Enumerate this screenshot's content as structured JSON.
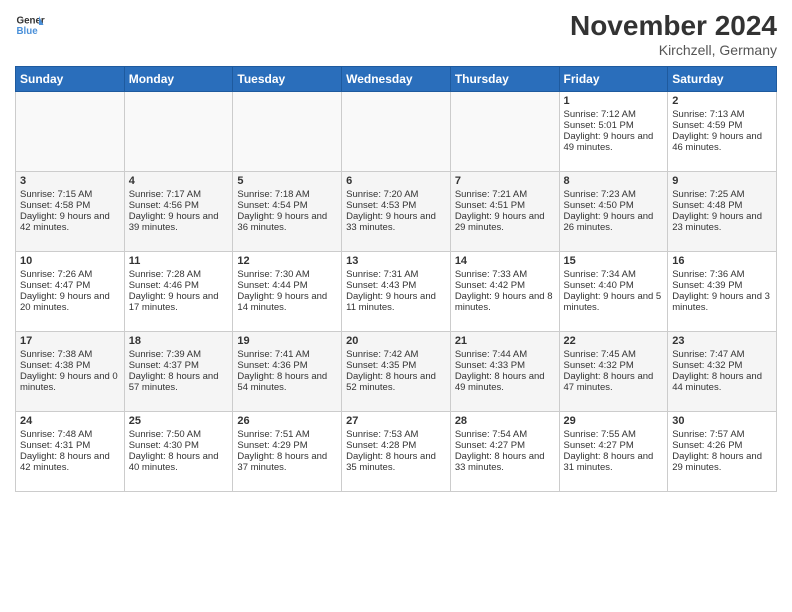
{
  "header": {
    "logo_line1": "General",
    "logo_line2": "Blue",
    "month": "November 2024",
    "location": "Kirchzell, Germany"
  },
  "weekdays": [
    "Sunday",
    "Monday",
    "Tuesday",
    "Wednesday",
    "Thursday",
    "Friday",
    "Saturday"
  ],
  "weeks": [
    [
      {
        "day": "",
        "info": ""
      },
      {
        "day": "",
        "info": ""
      },
      {
        "day": "",
        "info": ""
      },
      {
        "day": "",
        "info": ""
      },
      {
        "day": "",
        "info": ""
      },
      {
        "day": "1",
        "info": "Sunrise: 7:12 AM\nSunset: 5:01 PM\nDaylight: 9 hours and 49 minutes."
      },
      {
        "day": "2",
        "info": "Sunrise: 7:13 AM\nSunset: 4:59 PM\nDaylight: 9 hours and 46 minutes."
      }
    ],
    [
      {
        "day": "3",
        "info": "Sunrise: 7:15 AM\nSunset: 4:58 PM\nDaylight: 9 hours and 42 minutes."
      },
      {
        "day": "4",
        "info": "Sunrise: 7:17 AM\nSunset: 4:56 PM\nDaylight: 9 hours and 39 minutes."
      },
      {
        "day": "5",
        "info": "Sunrise: 7:18 AM\nSunset: 4:54 PM\nDaylight: 9 hours and 36 minutes."
      },
      {
        "day": "6",
        "info": "Sunrise: 7:20 AM\nSunset: 4:53 PM\nDaylight: 9 hours and 33 minutes."
      },
      {
        "day": "7",
        "info": "Sunrise: 7:21 AM\nSunset: 4:51 PM\nDaylight: 9 hours and 29 minutes."
      },
      {
        "day": "8",
        "info": "Sunrise: 7:23 AM\nSunset: 4:50 PM\nDaylight: 9 hours and 26 minutes."
      },
      {
        "day": "9",
        "info": "Sunrise: 7:25 AM\nSunset: 4:48 PM\nDaylight: 9 hours and 23 minutes."
      }
    ],
    [
      {
        "day": "10",
        "info": "Sunrise: 7:26 AM\nSunset: 4:47 PM\nDaylight: 9 hours and 20 minutes."
      },
      {
        "day": "11",
        "info": "Sunrise: 7:28 AM\nSunset: 4:46 PM\nDaylight: 9 hours and 17 minutes."
      },
      {
        "day": "12",
        "info": "Sunrise: 7:30 AM\nSunset: 4:44 PM\nDaylight: 9 hours and 14 minutes."
      },
      {
        "day": "13",
        "info": "Sunrise: 7:31 AM\nSunset: 4:43 PM\nDaylight: 9 hours and 11 minutes."
      },
      {
        "day": "14",
        "info": "Sunrise: 7:33 AM\nSunset: 4:42 PM\nDaylight: 9 hours and 8 minutes."
      },
      {
        "day": "15",
        "info": "Sunrise: 7:34 AM\nSunset: 4:40 PM\nDaylight: 9 hours and 5 minutes."
      },
      {
        "day": "16",
        "info": "Sunrise: 7:36 AM\nSunset: 4:39 PM\nDaylight: 9 hours and 3 minutes."
      }
    ],
    [
      {
        "day": "17",
        "info": "Sunrise: 7:38 AM\nSunset: 4:38 PM\nDaylight: 9 hours and 0 minutes."
      },
      {
        "day": "18",
        "info": "Sunrise: 7:39 AM\nSunset: 4:37 PM\nDaylight: 8 hours and 57 minutes."
      },
      {
        "day": "19",
        "info": "Sunrise: 7:41 AM\nSunset: 4:36 PM\nDaylight: 8 hours and 54 minutes."
      },
      {
        "day": "20",
        "info": "Sunrise: 7:42 AM\nSunset: 4:35 PM\nDaylight: 8 hours and 52 minutes."
      },
      {
        "day": "21",
        "info": "Sunrise: 7:44 AM\nSunset: 4:33 PM\nDaylight: 8 hours and 49 minutes."
      },
      {
        "day": "22",
        "info": "Sunrise: 7:45 AM\nSunset: 4:32 PM\nDaylight: 8 hours and 47 minutes."
      },
      {
        "day": "23",
        "info": "Sunrise: 7:47 AM\nSunset: 4:32 PM\nDaylight: 8 hours and 44 minutes."
      }
    ],
    [
      {
        "day": "24",
        "info": "Sunrise: 7:48 AM\nSunset: 4:31 PM\nDaylight: 8 hours and 42 minutes."
      },
      {
        "day": "25",
        "info": "Sunrise: 7:50 AM\nSunset: 4:30 PM\nDaylight: 8 hours and 40 minutes."
      },
      {
        "day": "26",
        "info": "Sunrise: 7:51 AM\nSunset: 4:29 PM\nDaylight: 8 hours and 37 minutes."
      },
      {
        "day": "27",
        "info": "Sunrise: 7:53 AM\nSunset: 4:28 PM\nDaylight: 8 hours and 35 minutes."
      },
      {
        "day": "28",
        "info": "Sunrise: 7:54 AM\nSunset: 4:27 PM\nDaylight: 8 hours and 33 minutes."
      },
      {
        "day": "29",
        "info": "Sunrise: 7:55 AM\nSunset: 4:27 PM\nDaylight: 8 hours and 31 minutes."
      },
      {
        "day": "30",
        "info": "Sunrise: 7:57 AM\nSunset: 4:26 PM\nDaylight: 8 hours and 29 minutes."
      }
    ]
  ]
}
